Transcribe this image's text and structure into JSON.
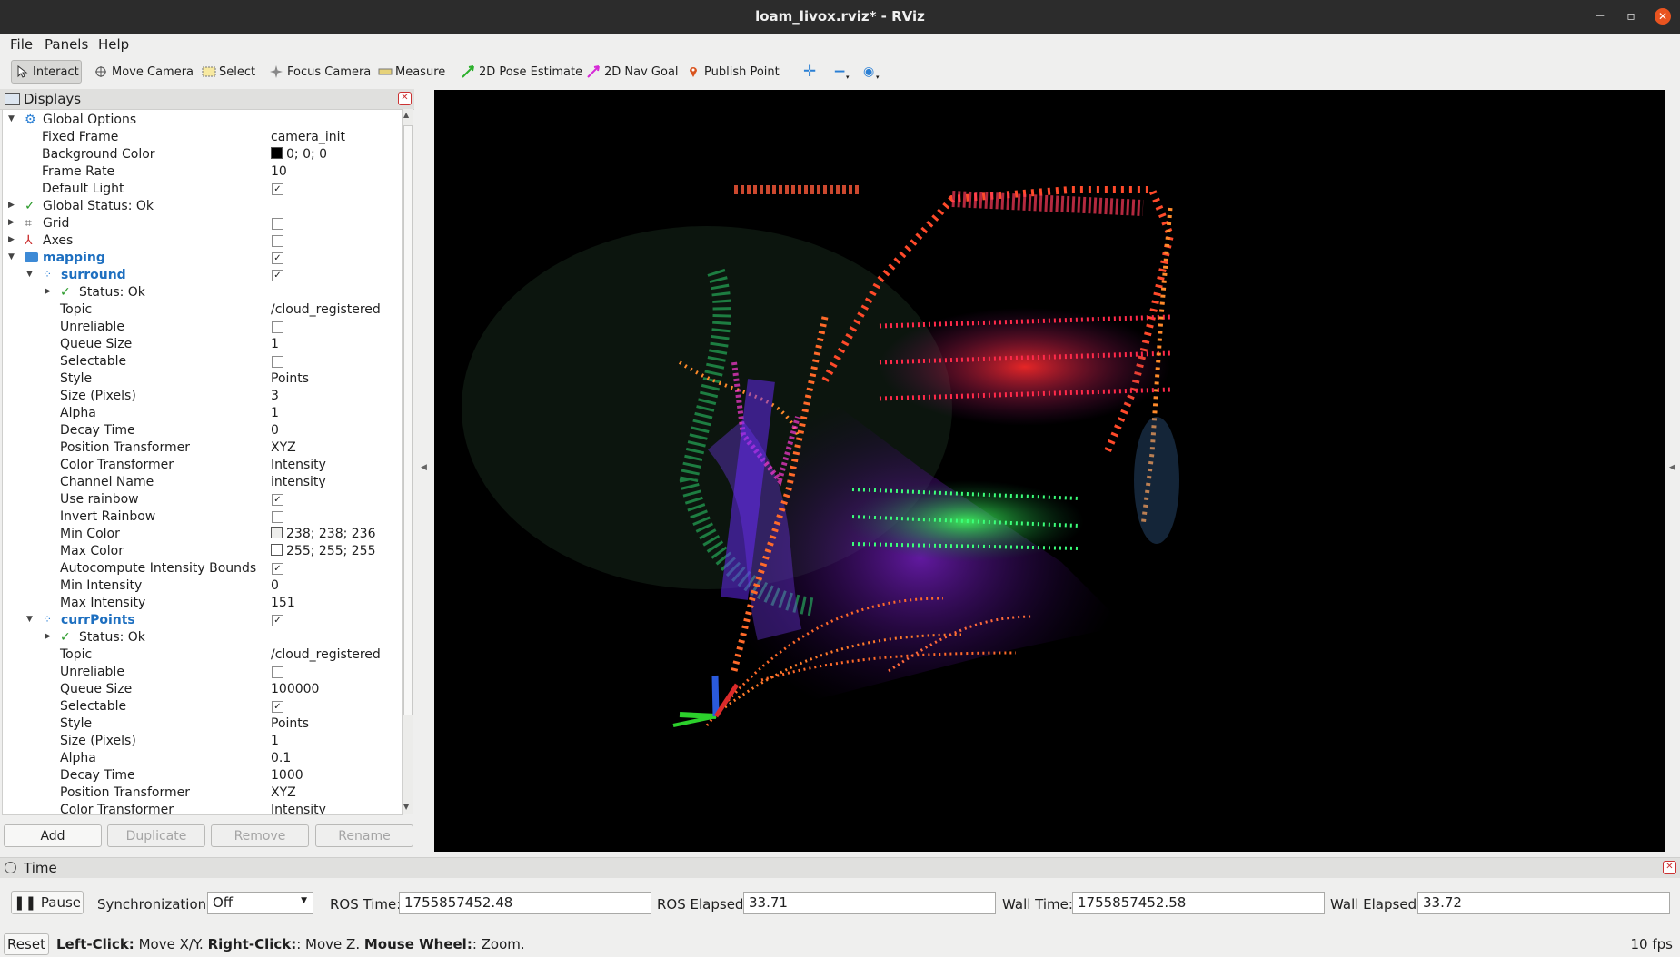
{
  "window": {
    "title": "loam_livox.rviz* - RViz"
  },
  "menu": {
    "file": "File",
    "panels": "Panels",
    "help": "Help"
  },
  "toolbar": {
    "interact": "Interact",
    "move_camera": "Move Camera",
    "select": "Select",
    "focus_camera": "Focus Camera",
    "measure": "Measure",
    "pose_estimate": "2D Pose Estimate",
    "nav_goal": "2D Nav Goal",
    "publish_point": "Publish Point"
  },
  "displays": {
    "title": "Displays",
    "global_options": "Global Options",
    "fixed_frame_label": "Fixed Frame",
    "fixed_frame": "camera_init",
    "bg_color_label": "Background Color",
    "bg_color": "0; 0; 0",
    "frame_rate_label": "Frame Rate",
    "frame_rate": "10",
    "default_light_label": "Default Light",
    "global_status": "Global Status: Ok",
    "grid": "Grid",
    "axes": "Axes",
    "mapping": "mapping",
    "surround": {
      "name": "surround",
      "status": "Status: Ok",
      "topic_label": "Topic",
      "topic": "/cloud_registered",
      "unreliable_label": "Unreliable",
      "queue_size_label": "Queue Size",
      "queue_size": "1",
      "selectable_label": "Selectable",
      "style_label": "Style",
      "style": "Points",
      "size_label": "Size (Pixels)",
      "size": "3",
      "alpha_label": "Alpha",
      "alpha": "1",
      "decay_label": "Decay Time",
      "decay": "0",
      "pos_tf_label": "Position Transformer",
      "pos_tf": "XYZ",
      "color_tf_label": "Color Transformer",
      "color_tf": "Intensity",
      "channel_label": "Channel Name",
      "channel": "intensity",
      "use_rainbow_label": "Use rainbow",
      "invert_rainbow_label": "Invert Rainbow",
      "min_color_label": "Min Color",
      "min_color": "238; 238; 236",
      "max_color_label": "Max Color",
      "max_color": "255; 255; 255",
      "autocompute_label": "Autocompute Intensity Bounds",
      "min_int_label": "Min Intensity",
      "min_int": "0",
      "max_int_label": "Max Intensity",
      "max_int": "151"
    },
    "currpoints": {
      "name": "currPoints",
      "status": "Status: Ok",
      "topic_label": "Topic",
      "topic": "/cloud_registered",
      "unreliable_label": "Unreliable",
      "queue_size_label": "Queue Size",
      "queue_size": "100000",
      "selectable_label": "Selectable",
      "style_label": "Style",
      "style": "Points",
      "size_label": "Size (Pixels)",
      "size": "1",
      "alpha_label": "Alpha",
      "alpha": "0.1",
      "decay_label": "Decay Time",
      "decay": "1000",
      "pos_tf_label": "Position Transformer",
      "pos_tf": "XYZ",
      "color_tf_label": "Color Transformer",
      "color_tf": "Intensity"
    },
    "buttons": {
      "add": "Add",
      "duplicate": "Duplicate",
      "remove": "Remove",
      "rename": "Rename"
    }
  },
  "time": {
    "title": "Time",
    "pause": "Pause",
    "sync_label": "Synchronization:",
    "sync_value": "Off",
    "ros_time_label": "ROS Time:",
    "ros_time": "1755857452.48",
    "ros_elapsed_label": "ROS Elapsed:",
    "ros_elapsed": "33.71",
    "wall_time_label": "Wall Time:",
    "wall_time": "1755857452.58",
    "wall_elapsed_label": "Wall Elapsed:",
    "wall_elapsed": "33.72"
  },
  "status": {
    "reset": "Reset",
    "left_click": "Left-Click:",
    "left_action": " Move X/Y. ",
    "right_click": "Right-Click:",
    "right_action": ": Move Z. ",
    "wheel": "Mouse Wheel:",
    "wheel_action": ": Zoom.",
    "fps": "10 fps"
  },
  "colors": {
    "bg_swatch": "#000000",
    "min_swatch": "#eeeeec",
    "max_swatch": "#ffffff",
    "accent": "#e95420"
  }
}
